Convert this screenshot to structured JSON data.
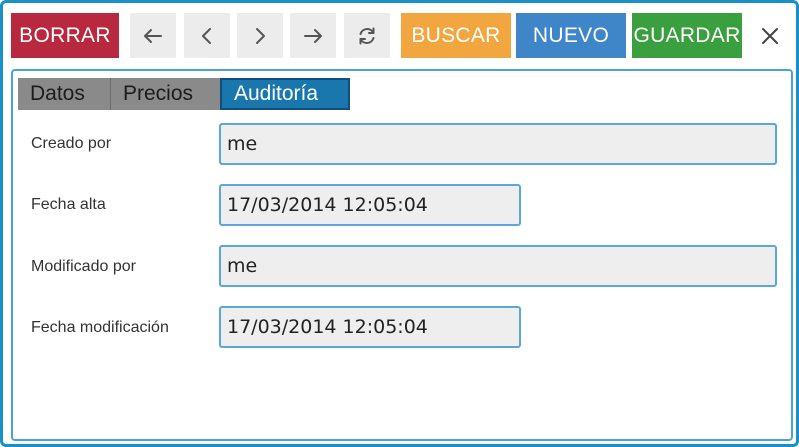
{
  "toolbar": {
    "delete_label": "BORRAR",
    "search_label": "BUSCAR",
    "new_label": "NUEVO",
    "save_label": "GUARDAR",
    "nav_icons": [
      "arrow-left-icon",
      "chevron-left-icon",
      "chevron-right-icon",
      "arrow-right-icon",
      "refresh-icon"
    ],
    "close_icon": "close-icon"
  },
  "tabs": [
    {
      "label": "Datos",
      "active": false
    },
    {
      "label": "Precios",
      "active": false
    },
    {
      "label": "Auditoría",
      "active": true
    }
  ],
  "fields": [
    {
      "label": "Creado por",
      "value": "me"
    },
    {
      "label": "Fecha alta",
      "value": "17/03/2014 12:05:04"
    },
    {
      "label": "Modificado por",
      "value": "me"
    },
    {
      "label": "Fecha modificación",
      "value": "17/03/2014 12:05:04"
    }
  ],
  "colors": {
    "delete": "#b8283f",
    "search": "#f2a640",
    "new": "#3f86c8",
    "save": "#3a9f3e",
    "accent": "#1a90c8"
  }
}
